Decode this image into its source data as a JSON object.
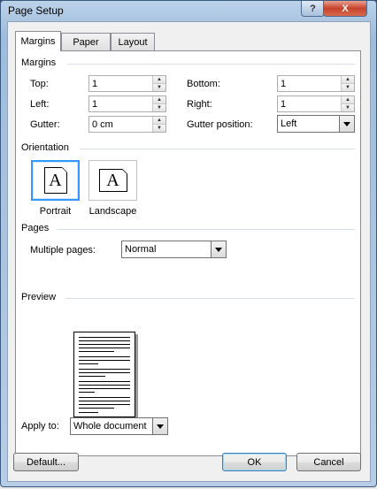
{
  "window": {
    "title": "Page Setup",
    "help_label": "?",
    "close_label": "X"
  },
  "tabs": [
    {
      "label": "Margins",
      "active": true
    },
    {
      "label": "Paper",
      "active": false
    },
    {
      "label": "Layout",
      "active": false
    }
  ],
  "margins": {
    "section_label": "Margins",
    "top": {
      "label": "Top:",
      "value": "1"
    },
    "bottom": {
      "label": "Bottom:",
      "value": "1"
    },
    "left": {
      "label": "Left:",
      "value": "1"
    },
    "right": {
      "label": "Right:",
      "value": "1"
    },
    "gutter": {
      "label": "Gutter:",
      "value": "0 cm"
    },
    "gutter_position": {
      "label": "Gutter position:",
      "value": "Left"
    }
  },
  "orientation": {
    "section_label": "Orientation",
    "portrait_label": "Portrait",
    "landscape_label": "Landscape",
    "icon_glyph": "A",
    "selected": "Portrait"
  },
  "pages": {
    "section_label": "Pages",
    "multiple_pages_label": "Multiple pages:",
    "multiple_pages_value": "Normal"
  },
  "preview": {
    "section_label": "Preview",
    "apply_to_label": "Apply to:",
    "apply_to_value": "Whole document"
  },
  "buttons": {
    "default_label": "Default...",
    "ok_label": "OK",
    "cancel_label": "Cancel"
  },
  "colors": {
    "selection_border": "#3399ff",
    "close_button": "#c7432b",
    "frame": "#9fbcdc"
  }
}
